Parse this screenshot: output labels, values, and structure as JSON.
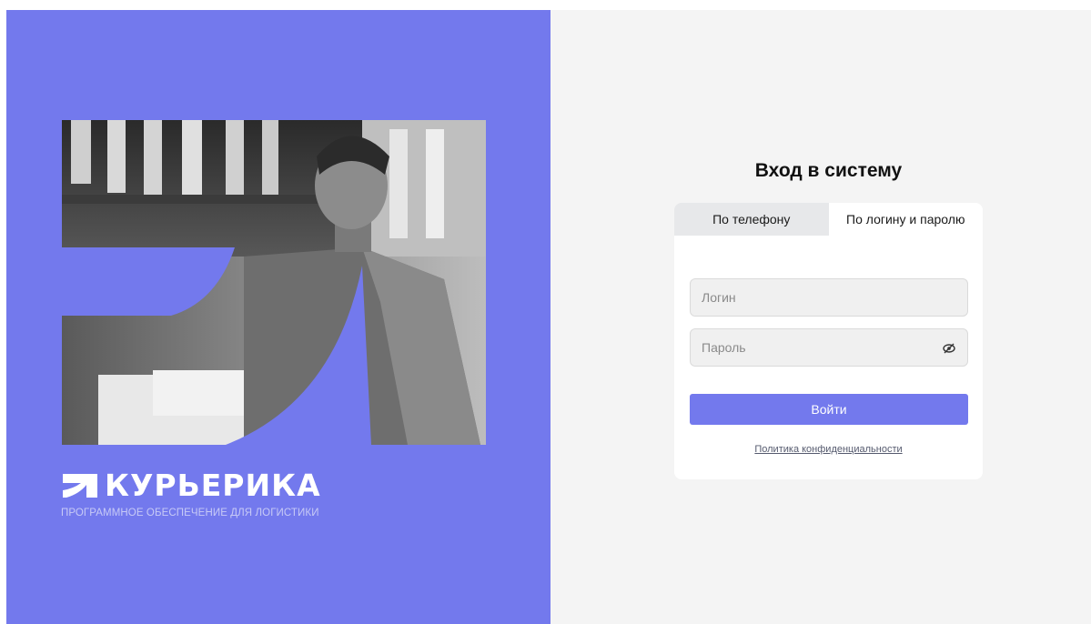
{
  "brand": {
    "name": "КУРЬЕРИКА",
    "tagline": "ПРОГРАММНОЕ ОБЕСПЕЧЕНИЕ ДЛЯ ЛОГИСТИКИ"
  },
  "login": {
    "title": "Вход в систему",
    "tabs": [
      {
        "label": "По телефону",
        "active": false
      },
      {
        "label": "По логину и паролю",
        "active": true
      }
    ],
    "login_placeholder": "Логин",
    "password_placeholder": "Пароль",
    "submit_label": "Войти",
    "privacy_link": "Политика конфиденциальности"
  },
  "colors": {
    "brand_purple": "#7379ED",
    "background": "#F4F4F4",
    "card": "#FFFFFF"
  },
  "icons": {
    "password_toggle": "eye-off-icon",
    "brand_mark": "kurierika-logo-mark"
  }
}
